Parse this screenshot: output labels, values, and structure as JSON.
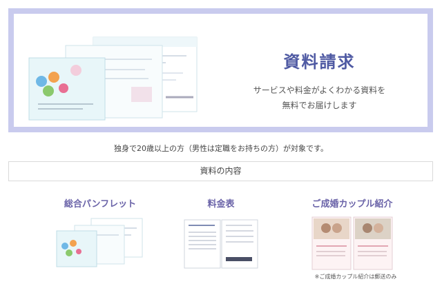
{
  "hero": {
    "title": "資料請求",
    "desc_line1": "サービスや料金がよくわかる資料を",
    "desc_line2": "無料でお届けします",
    "thumb_icon": "brochure-spread-image"
  },
  "target_text": "独身で20歳以上の方（男性は定職をお持ちの方）が対象です。",
  "contents_heading": "資料の内容",
  "items": [
    {
      "title": "総合パンフレット",
      "thumb_icon": "pamphlet-image"
    },
    {
      "title": "料金表",
      "thumb_icon": "price-list-image"
    },
    {
      "title": "ご成婚カップル紹介",
      "thumb_icon": "couple-introduction-image"
    }
  ],
  "couple_note": "※ご成婚カップル紹介は郵送のみ",
  "colors": {
    "hero_border": "#c9cbee",
    "hero_title": "#4f5aa3",
    "item_title": "#6a63a8"
  }
}
